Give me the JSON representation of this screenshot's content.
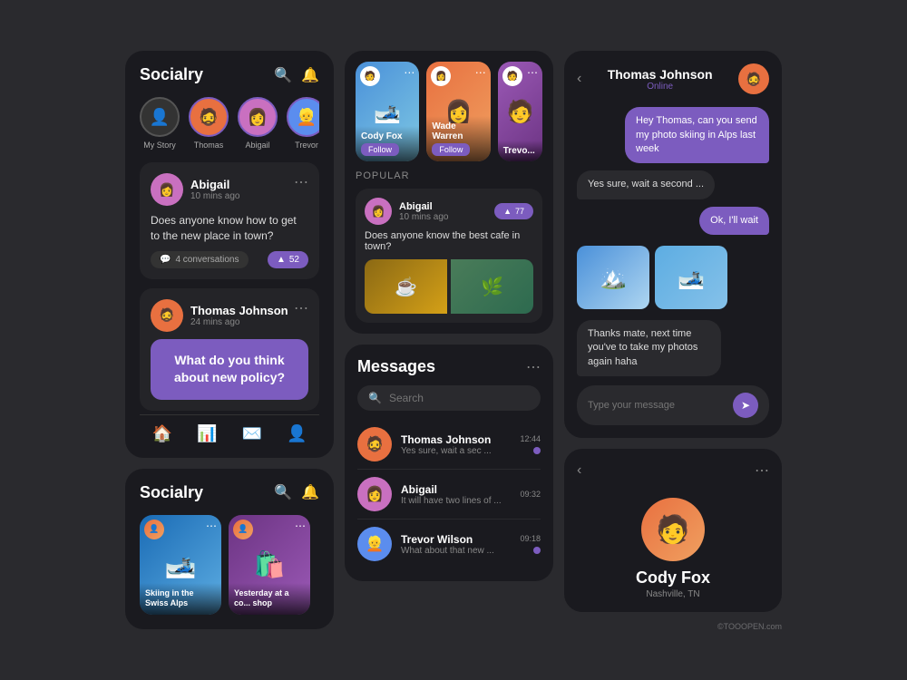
{
  "app": {
    "title": "Socialry",
    "search_icon": "🔍",
    "bell_icon": "🔔"
  },
  "stories": [
    {
      "label": "My Story",
      "emoji": "👤"
    },
    {
      "label": "Thomas",
      "emoji": "🧔"
    },
    {
      "label": "Abigail",
      "emoji": "👩"
    },
    {
      "label": "Trevor",
      "emoji": "👱"
    }
  ],
  "posts": [
    {
      "user": "Abigail",
      "time": "10 mins ago",
      "content": "Does anyone know how to get to the new place in town?",
      "conversations": "4 conversations",
      "upvotes": "52"
    },
    {
      "user": "Thomas Johnson",
      "time": "24 mins ago",
      "content": "What do you think about new policy?"
    }
  ],
  "explore_stories": [
    {
      "name": "Cody Fox",
      "type": "ski",
      "has_follow": true
    },
    {
      "name": "Wade Warren",
      "type": "orange",
      "has_follow": true
    },
    {
      "name": "Trevo...",
      "type": "purple",
      "has_follow": true
    }
  ],
  "popular": {
    "label": "POPULAR",
    "post": {
      "user": "Abigail",
      "time": "10 mins ago",
      "upvotes": "77",
      "question": "Does anyone know the best cafe in town?"
    }
  },
  "messages": {
    "title": "Messages",
    "search_placeholder": "Search",
    "items": [
      {
        "name": "Thomas Johnson",
        "preview": "Yes sure, wait a sec ...",
        "time": "12:44",
        "has_dot": true
      },
      {
        "name": "Abigail",
        "preview": "It will have two lines of ...",
        "time": "09:32",
        "has_dot": false
      },
      {
        "name": "Trevor Wilson",
        "preview": "What about that new ...",
        "time": "09:18",
        "has_dot": true
      }
    ]
  },
  "chat": {
    "username": "Thomas Johnson",
    "status": "Online",
    "messages": [
      {
        "type": "sent",
        "text": "Hey Thomas, can you send my photo skiing in Alps last week"
      },
      {
        "type": "received",
        "text": "Yes sure, wait a second ..."
      },
      {
        "type": "sent",
        "text": "Ok, I'll wait"
      },
      {
        "type": "received",
        "text": "Thanks mate, next time you've to take my photos again haha"
      }
    ],
    "input_placeholder": "Type your message"
  },
  "profile": {
    "name": "Cody Fox",
    "location": "Nashville, TN"
  },
  "bottom_stories": [
    {
      "label": "Skiing in the Swiss Alps",
      "type": "alps"
    },
    {
      "label": "Yesterday at a co... shop",
      "type": "shop"
    }
  ],
  "nav": [
    "🏠",
    "📊",
    "✉️",
    "👤"
  ],
  "watermark": "©TOOOPEN.com"
}
